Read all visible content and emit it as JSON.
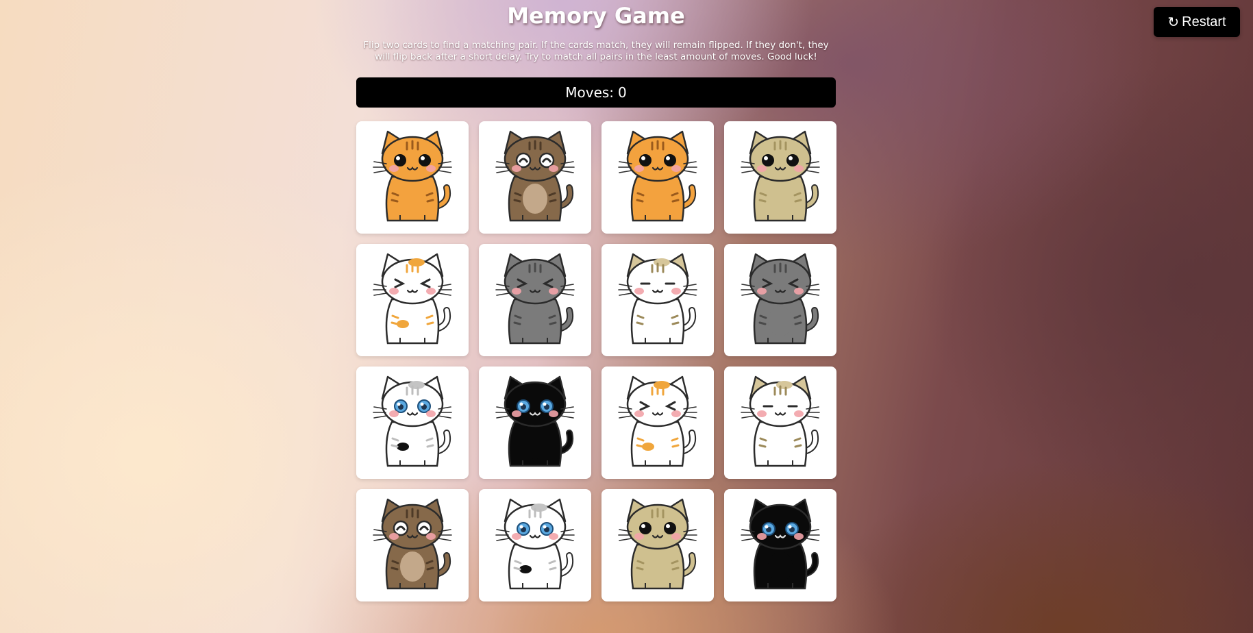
{
  "header": {
    "title": "Memory Game",
    "instructions": "Flip two cards to find a matching pair. If the cards match, they will remain flipped. If they don't, they will flip back after a short delay. Try to match all pairs in the least amount of moves. Good luck!",
    "restart_icon": "↻",
    "restart_label": "Restart"
  },
  "moves": {
    "label": "Moves:",
    "value": "0"
  },
  "cat_styles": {
    "orange-tabby": {
      "body": "#f3a23e",
      "ears": "#f3a23e",
      "stripes": "#9a5a1c",
      "eyes": "dot-big",
      "belly": "#f3a23e",
      "spots": []
    },
    "brown-tabby": {
      "body": "#86694a",
      "ears": "#86694a",
      "stripes": "#4e3a27",
      "eyes": "arc-white",
      "belly": "#c3a88a",
      "spots": []
    },
    "beige": {
      "body": "#cfc08f",
      "ears": "#cfc08f",
      "stripes": "#a49460",
      "eyes": "dot-big",
      "belly": "#cfc08f",
      "spots": []
    },
    "calico": {
      "body": "#ffffff",
      "ears": "#ffffff",
      "stripes": "#f0a63c",
      "eyes": "closed",
      "belly": "#ffffff",
      "spots": [
        "#f0a63c",
        "#f0a63c"
      ]
    },
    "gray-tabby": {
      "body": "#7b7b7b",
      "ears": "#7b7b7b",
      "stripes": "#4a4a4a",
      "eyes": "closed",
      "belly": "#7b7b7b",
      "spots": []
    },
    "cream-tabby": {
      "body": "#ffffff",
      "ears": "#d6c69a",
      "stripes": "#9c8a5a",
      "eyes": "line",
      "belly": "#ffffff",
      "spots": [
        "#d6c69a"
      ]
    },
    "white-spotted": {
      "body": "#ffffff",
      "ears": "#ffffff",
      "stripes": "#bdbdbd",
      "eyes": "blue",
      "belly": "#ffffff",
      "spots": [
        "#c4c4c4",
        "#111111"
      ]
    },
    "black": {
      "body": "#0a0a0a",
      "ears": "#0a0a0a",
      "stripes": "#0a0a0a",
      "eyes": "blue",
      "belly": "#0a0a0a",
      "spots": []
    }
  },
  "cards": [
    {
      "cat": "orange-tabby",
      "icon": "orange-tabby-cat-icon"
    },
    {
      "cat": "brown-tabby",
      "icon": "brown-tabby-cat-icon"
    },
    {
      "cat": "orange-tabby",
      "icon": "orange-tabby-cat-icon"
    },
    {
      "cat": "beige",
      "icon": "beige-cat-icon"
    },
    {
      "cat": "calico",
      "icon": "calico-cat-icon"
    },
    {
      "cat": "gray-tabby",
      "icon": "gray-tabby-cat-icon"
    },
    {
      "cat": "cream-tabby",
      "icon": "cream-tabby-cat-icon"
    },
    {
      "cat": "gray-tabby",
      "icon": "gray-tabby-cat-icon"
    },
    {
      "cat": "white-spotted",
      "icon": "white-spotted-cat-icon"
    },
    {
      "cat": "black",
      "icon": "black-cat-icon"
    },
    {
      "cat": "calico",
      "icon": "calico-cat-icon"
    },
    {
      "cat": "cream-tabby",
      "icon": "cream-tabby-cat-icon"
    },
    {
      "cat": "brown-tabby",
      "icon": "brown-tabby-cat-icon"
    },
    {
      "cat": "white-spotted",
      "icon": "white-spotted-cat-icon"
    },
    {
      "cat": "beige",
      "icon": "beige-cat-icon"
    },
    {
      "cat": "black",
      "icon": "black-cat-icon"
    }
  ]
}
